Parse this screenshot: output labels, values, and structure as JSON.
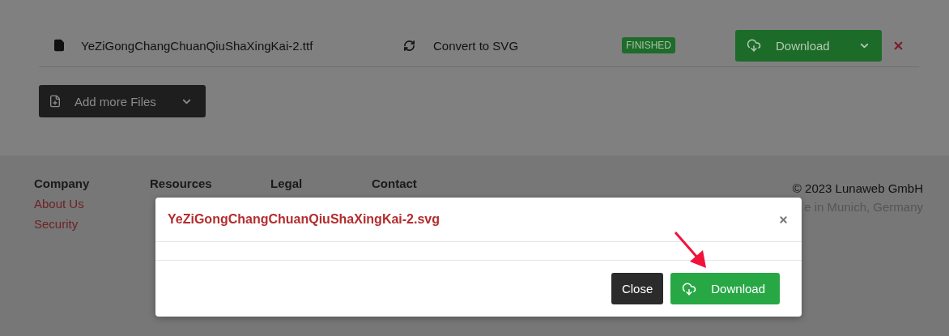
{
  "file_row": {
    "file_name": "YeZiGongChangChuanQiuShaXingKai-2.ttf",
    "action": "Convert to SVG",
    "status": "FINISHED",
    "download_button": "Download"
  },
  "add_files_button": "Add more Files",
  "footer": {
    "columns": [
      {
        "heading": "Company",
        "links": [
          "About Us",
          "Security"
        ]
      },
      {
        "heading": "Resources"
      },
      {
        "heading": "Legal"
      },
      {
        "heading": "Contact"
      }
    ],
    "copyright": "© 2023 Lunaweb GmbH",
    "location": "e in Munich, Germany"
  },
  "modal": {
    "title": "YeZiGongChangChuanQiuShaXingKai-2.svg",
    "buttons": [
      {
        "label": "Close",
        "kind": "secondary"
      },
      {
        "label": "Download",
        "kind": "primary"
      }
    ]
  }
}
